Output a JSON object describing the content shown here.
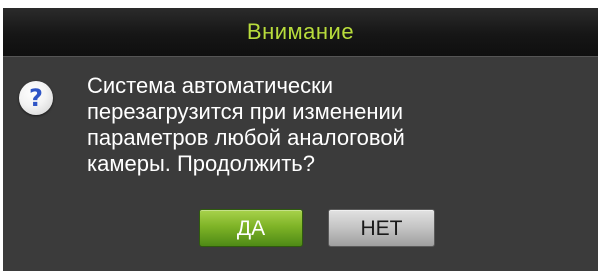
{
  "dialog": {
    "title": "Внимание",
    "icon": "question-icon",
    "icon_glyph": "?",
    "message_lines": [
      "Система автоматически",
      "перезагрузится при изменении",
      "параметров любой аналоговой",
      "камеры. Продолжить?"
    ],
    "buttons": {
      "yes_label": "ДА",
      "no_label": "НЕТ"
    }
  },
  "colors": {
    "title_text": "#b8dc3c",
    "body_background": "#3b3b3b",
    "primary_button": "#7fb427",
    "secondary_button": "#c3c3c3",
    "icon_glyph": "#2f55c6"
  }
}
